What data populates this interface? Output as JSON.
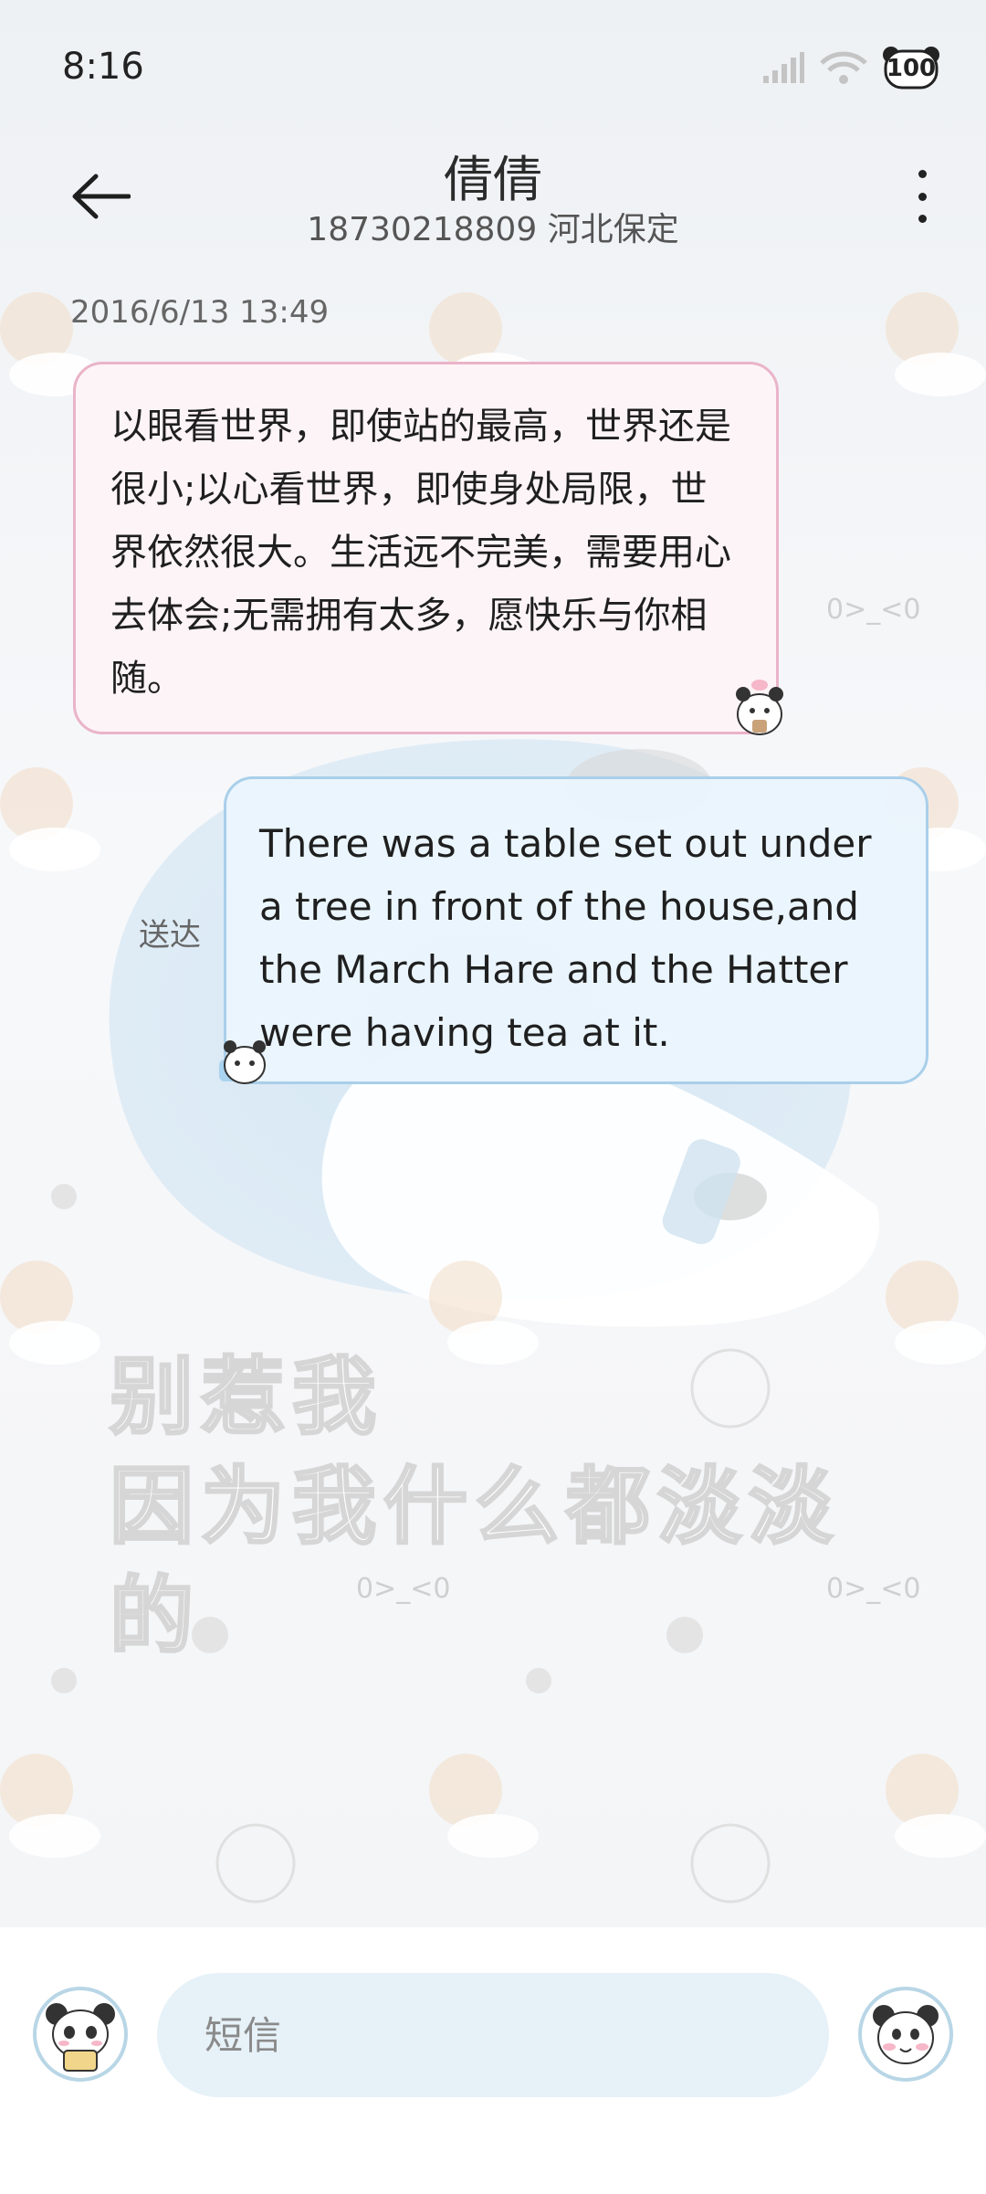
{
  "status_bar": {
    "time": "8:16",
    "battery": "100"
  },
  "header": {
    "title": "倩倩",
    "subtitle": "18730218809 河北保定"
  },
  "conversation": {
    "timestamp": "2016/6/13 13:49",
    "messages": [
      {
        "direction": "incoming",
        "text": "以眼看世界，即使站的最高，世界还是很小;以心看世界，即使身处局限，世界依然很大。生活远不完美，需要用心去体会;无需拥有太多，愿快乐与你相随。"
      },
      {
        "direction": "outgoing",
        "text": "There was a table set out under a tree in front of the house,and the March Hare and the Hatter were having tea at it.",
        "status": "送达"
      }
    ]
  },
  "wallpaper": {
    "caption_line1": "别惹我",
    "caption_line2": "因为我什么都淡淡的",
    "emoticon": "0>_<0"
  },
  "compose": {
    "placeholder": "短信"
  },
  "colors": {
    "incoming_bubble": "#fdf4f7",
    "incoming_border": "#eab4c8",
    "outgoing_bubble": "#eaf5fd",
    "outgoing_border": "#a9cfea",
    "input_bg": "#e6f1f8"
  }
}
